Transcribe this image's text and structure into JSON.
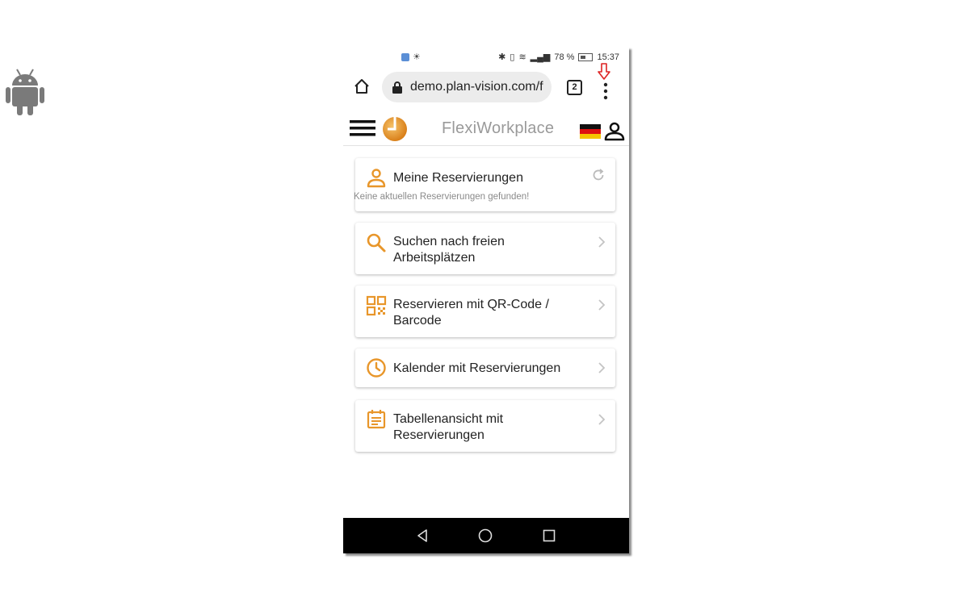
{
  "status_bar": {
    "battery_text": "78 %",
    "time": "15:37"
  },
  "browser": {
    "url": "demo.plan-vision.com/f",
    "tab_count": "2"
  },
  "app": {
    "title": "FlexiWorkplace",
    "accent_color": "#e8962a"
  },
  "cards": [
    {
      "title": "Meine Reservierungen",
      "subtitle": "Keine aktuellen Reservierungen gefunden!",
      "icon": "person-icon"
    },
    {
      "title": "Suchen nach freien Arbeitsplätzen",
      "icon": "search-icon"
    },
    {
      "title": "Reservieren mit QR-Code / Barcode",
      "icon": "qr-code-icon"
    },
    {
      "title": "Kalender mit Reservierungen",
      "icon": "clock-icon"
    },
    {
      "title": "Tabellenansicht mit Reservierungen",
      "icon": "table-view-icon"
    }
  ]
}
